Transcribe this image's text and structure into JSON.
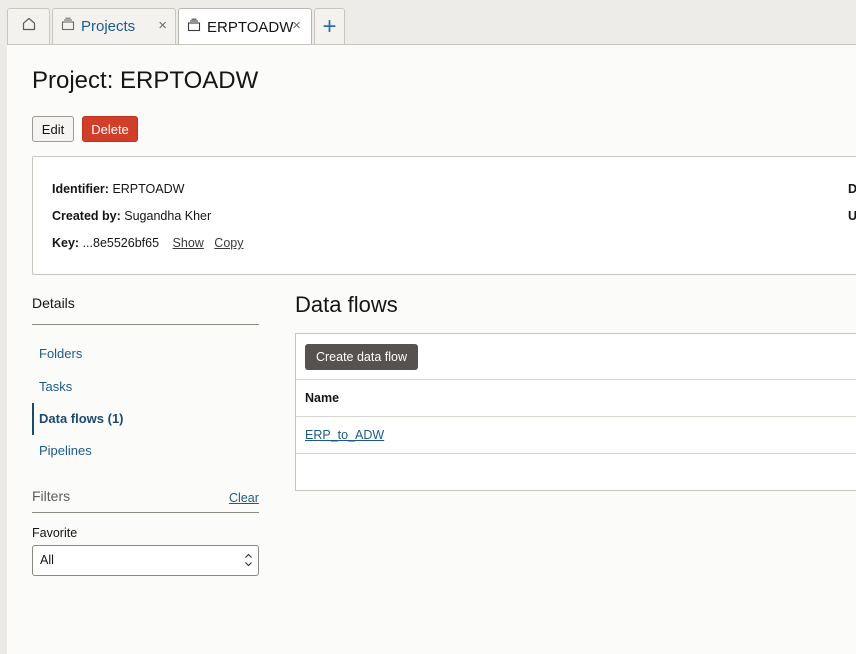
{
  "tabs": {
    "home": {
      "icon": "home-icon"
    },
    "projects": {
      "label": "Projects",
      "icon": "stack-icon",
      "close": "×"
    },
    "active": {
      "label": "ERPTOADW",
      "icon": "stack-icon",
      "close": "×"
    },
    "add": {
      "symbol": "+",
      "icon": "plus-icon"
    }
  },
  "page": {
    "title": "Project: ERPTOADW",
    "edit_label": "Edit",
    "delete_label": "Delete"
  },
  "info": {
    "identifier_label": "Identifier:",
    "identifier_value": "ERPTOADW",
    "created_by_label": "Created by:",
    "created_by_value": "Sugandha Kher",
    "key_label": "Key:",
    "key_value": "...8e5526bf65",
    "show_label": "Show",
    "copy_label": "Copy",
    "right_label_1": "D",
    "right_label_2": "U"
  },
  "nav": {
    "heading": "Details",
    "items": [
      {
        "label": "Folders"
      },
      {
        "label": "Tasks"
      },
      {
        "label": "Data flows (1)"
      },
      {
        "label": "Pipelines"
      }
    ],
    "active_index": 2
  },
  "filters": {
    "title": "Filters",
    "clear_label": "Clear",
    "favorite_label": "Favorite",
    "favorite_value": "All"
  },
  "data_flows": {
    "title": "Data flows",
    "create_label": "Create data flow",
    "column_name": "Name",
    "rows": [
      {
        "name": "ERP_to_ADW"
      }
    ]
  },
  "colors": {
    "delete": "#d13f2b",
    "link": "#1d5a8a",
    "create_button": "#55524f"
  }
}
